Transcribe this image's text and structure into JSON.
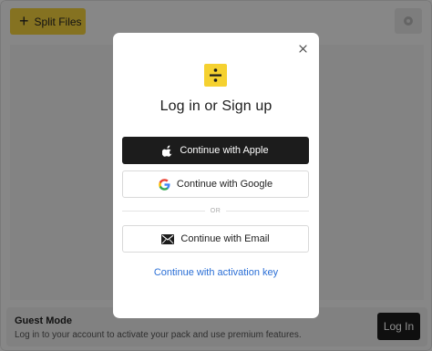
{
  "app": {
    "split_files_label": "Split Files",
    "settings_icon": "gear-icon"
  },
  "guest": {
    "title": "Guest Mode",
    "description": "Log in to your account to activate your pack and use premium features.",
    "login_label": "Log In"
  },
  "modal": {
    "title": "Log in or Sign up",
    "apple_label": "Continue with Apple",
    "google_label": "Continue with Google",
    "or_label": "OR",
    "email_label": "Continue with Email",
    "activation_label": "Continue with activation key"
  },
  "colors": {
    "brand_yellow": "#f5d130",
    "link_blue": "#2b6fd6",
    "dark_button": "#1c1c1c"
  }
}
